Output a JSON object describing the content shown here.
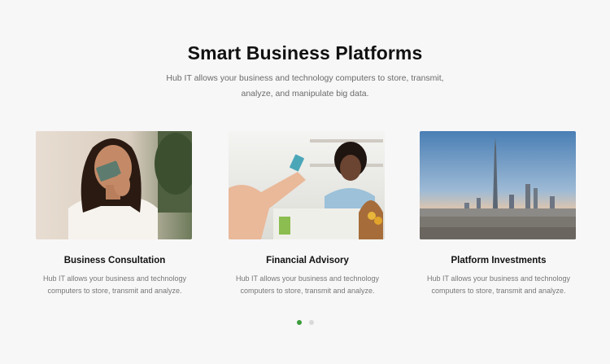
{
  "section": {
    "title": "Smart Business Platforms",
    "subtitle_line1": "Hub IT allows your business and technology computers to store, transmit,",
    "subtitle_line2": "analyze, and manipulate big data."
  },
  "cards": [
    {
      "title": "Business Consultation",
      "desc_line1": "Hub IT allows your business and technology",
      "desc_line2": "computers to store, transmit and analyze."
    },
    {
      "title": "Financial Advisory",
      "desc_line1": "Hub IT allows your business and technology",
      "desc_line2": "computers to store, transmit and analyze."
    },
    {
      "title": "Platform Investments",
      "desc_line1": "Hub IT allows your business and technology",
      "desc_line2": "computers to store, transmit and analyze."
    }
  ],
  "carousel": {
    "active_index": 0,
    "colors": {
      "active": "#3a9c3a",
      "inactive": "#d9d9d9"
    }
  }
}
